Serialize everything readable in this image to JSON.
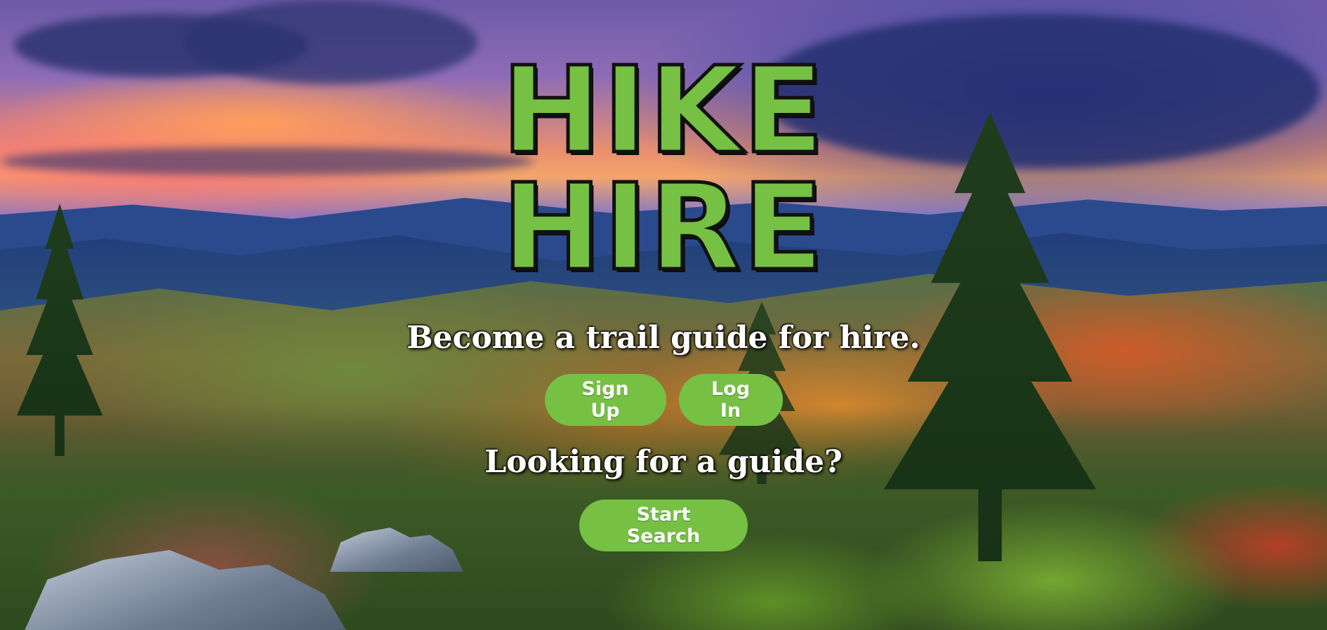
{
  "logo": {
    "line1": "HiKE",
    "line2": "HiRE",
    "color": "#76c043"
  },
  "hero": {
    "tagline": "Become a trail guide for hire.",
    "subheading": "Looking for a guide?"
  },
  "buttons": {
    "signup_label": "Sign Up",
    "login_label": "Log In",
    "search_label": "Start Search"
  },
  "colors": {
    "accent": "#76c043",
    "text": "#ffffff"
  }
}
